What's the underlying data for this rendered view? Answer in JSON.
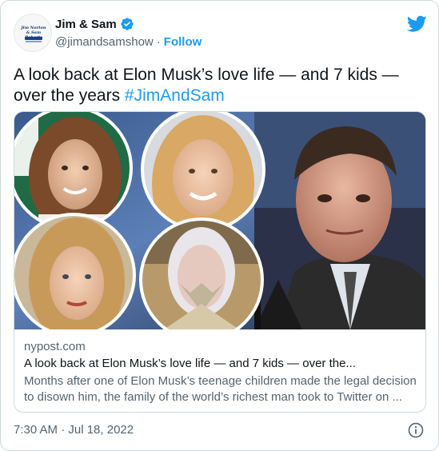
{
  "header": {
    "avatar_text_line1": "Jim Norton & Sam Roberts",
    "display_name": "Jim & Sam",
    "verified_icon": "verified-badge-icon",
    "handle": "@jimandsamshow",
    "separator": "·",
    "follow_label": "Follow",
    "logo_icon": "twitter-bird-icon"
  },
  "tweet": {
    "text": "A look back at Elon Musk’s love life — and 7 kids — over the years",
    "hashtag": "#JimAndSam"
  },
  "card": {
    "domain": "nypost.com",
    "title": "A look back at Elon Musk’s love life — and 7 kids — over the...",
    "description": "Months after one of Elon Musk’s teenage children made the legal decision to disown him, the family of the world’s richest man took to Twitter on ..."
  },
  "footer": {
    "timestamp": "7:30 AM · Jul 18, 2022",
    "info_icon": "info-icon"
  },
  "colors": {
    "accent": "#1d9bf0",
    "text_primary": "#0f1419",
    "text_secondary": "#536471",
    "border": "#cfd9de"
  }
}
